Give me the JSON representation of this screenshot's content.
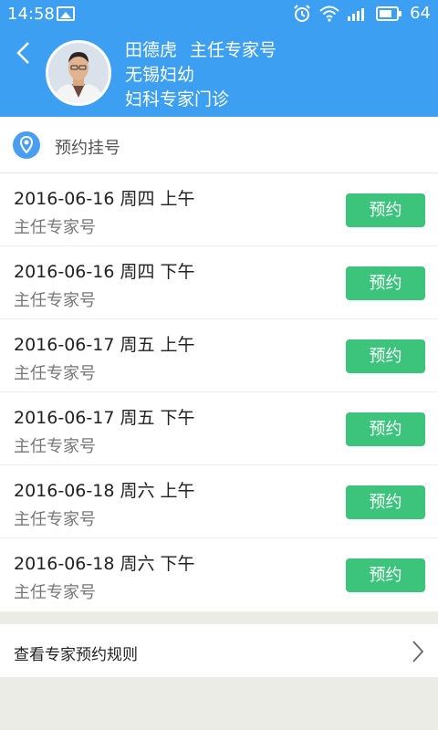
{
  "status_bar": {
    "time": "14:58",
    "battery": "64",
    "icons": [
      "image-icon",
      "alarm-icon",
      "wifi-icon",
      "signal-icon",
      "battery-icon"
    ]
  },
  "header": {
    "doctor_name": "田德虎",
    "title": "主任专家号",
    "hospital": "无锡妇幼",
    "department": "妇科专家门诊"
  },
  "section": {
    "title": "预约挂号"
  },
  "slots": [
    {
      "date": "2016-06-16 周四 上午",
      "type": "主任专家号",
      "button": "预约"
    },
    {
      "date": "2016-06-16 周四 下午",
      "type": "主任专家号",
      "button": "预约"
    },
    {
      "date": "2016-06-17 周五 上午",
      "type": "主任专家号",
      "button": "预约"
    },
    {
      "date": "2016-06-17 周五 下午",
      "type": "主任专家号",
      "button": "预约"
    },
    {
      "date": "2016-06-18 周六 上午",
      "type": "主任专家号",
      "button": "预约"
    },
    {
      "date": "2016-06-18 周六 下午",
      "type": "主任专家号",
      "button": "预约"
    }
  ],
  "rules_link": {
    "label": "查看专家预约规则"
  },
  "colors": {
    "header": "#3d9ff2",
    "button": "#3cc47c",
    "background": "#ecece6"
  }
}
